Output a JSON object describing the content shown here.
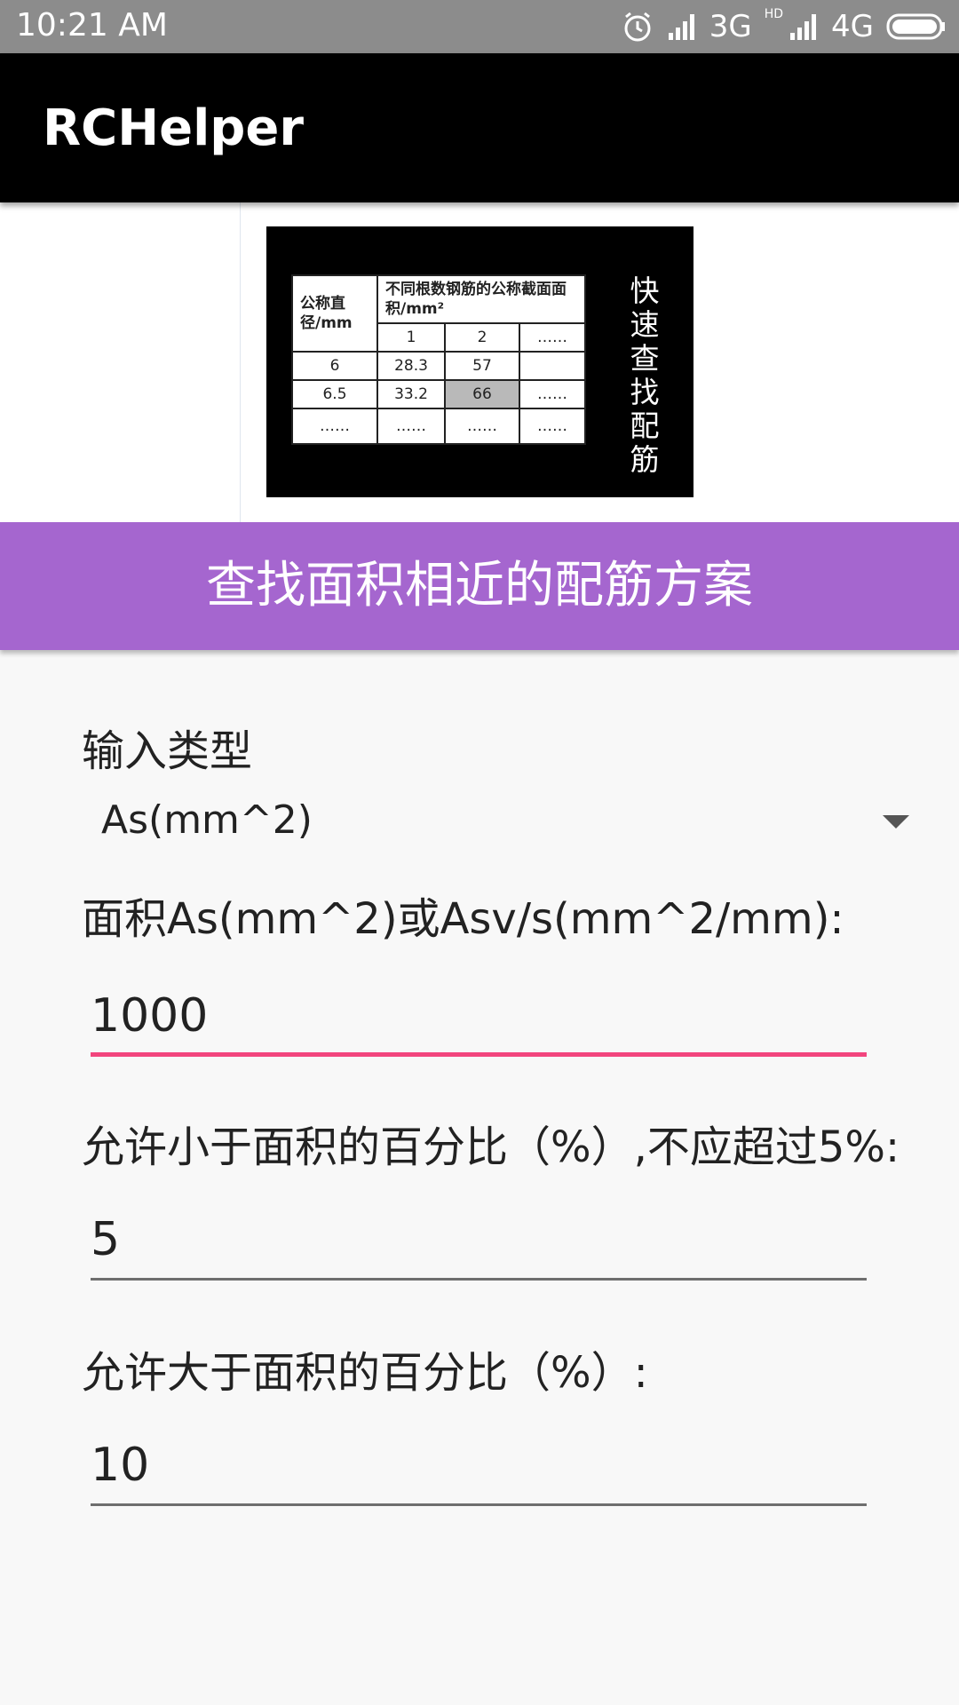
{
  "status_bar": {
    "time": "10:21  AM",
    "network_3g": "3G",
    "hd": "HD",
    "network_4g": "4G"
  },
  "app_bar": {
    "title": "RCHelper"
  },
  "banner": {
    "header_col1": "公称直径/mm",
    "header_col2": "不同根数钢筋的公称截面面积/mm²",
    "sub_headers": [
      "1",
      "2",
      "……"
    ],
    "rows": [
      [
        "6",
        "28.3",
        "57",
        ""
      ],
      [
        "6.5",
        "33.2",
        "66",
        "……"
      ],
      [
        "……",
        "……",
        "……",
        "……"
      ]
    ],
    "vertical_text": "快速查找配筋"
  },
  "search_button": {
    "label": "查找面积相近的配筋方案"
  },
  "form": {
    "input_type_label": "输入类型",
    "input_type_value": "As(mm^2)",
    "area_label": "面积As(mm^2)或Asv/s(mm^2/mm):",
    "area_value": "1000",
    "lower_pct_label": "允许小于面积的百分比（%）,不应超过5%:",
    "lower_pct_value": "5",
    "upper_pct_label": "允许大于面积的百分比（%）:",
    "upper_pct_value": "10"
  },
  "colors": {
    "status_bar": "#8c8c8c",
    "app_bar": "#000000",
    "accent_button": "#a566cf",
    "focus_underline": "#f2457e"
  },
  "icons": [
    "alarm-icon",
    "signal-icon",
    "signal-icon",
    "battery-icon",
    "dropdown-arrow-icon"
  ]
}
